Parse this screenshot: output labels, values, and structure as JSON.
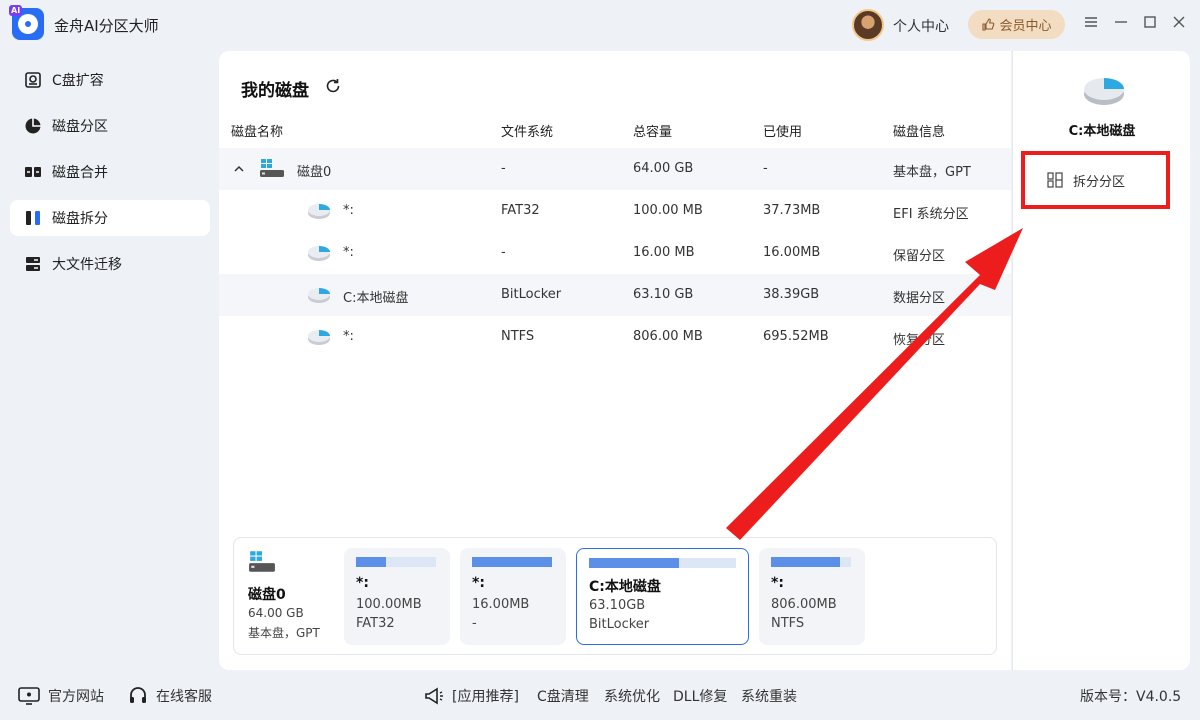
{
  "app": {
    "title": "金舟AI分区大师",
    "logo_badge": "AI"
  },
  "header": {
    "personal_center": "个人中心",
    "vip_center": "会员中心"
  },
  "sidebar": {
    "items": [
      {
        "label": "C盘扩容",
        "icon": "disk-expand-icon"
      },
      {
        "label": "磁盘分区",
        "icon": "pie-partition-icon"
      },
      {
        "label": "磁盘合并",
        "icon": "merge-icon"
      },
      {
        "label": "磁盘拆分",
        "icon": "split-icon",
        "active": true
      },
      {
        "label": "大文件迁移",
        "icon": "file-migrate-icon"
      }
    ]
  },
  "main": {
    "title": "我的磁盘",
    "columns": [
      "磁盘名称",
      "文件系统",
      "总容量",
      "已使用",
      "磁盘信息"
    ],
    "disk_row": {
      "name": "磁盘0",
      "fs": "-",
      "total": "64.00 GB",
      "used": "-",
      "info": "基本盘，GPT"
    },
    "partitions": [
      {
        "name": "*:",
        "fs": "FAT32",
        "total": "100.00 MB",
        "used": "37.73MB",
        "info": "EFI 系统分区"
      },
      {
        "name": "*:",
        "fs": "-",
        "total": "16.00 MB",
        "used": "16.00MB",
        "info": "保留分区"
      },
      {
        "name": "C:本地磁盘",
        "fs": "BitLocker",
        "total": "63.10 GB",
        "used": "38.39GB",
        "info": "数据分区"
      },
      {
        "name": "*:",
        "fs": "NTFS",
        "total": "806.00 MB",
        "used": "695.52MB",
        "info": "恢复分区"
      }
    ]
  },
  "disk_map": {
    "disk": {
      "name": "磁盘0",
      "size": "64.00 GB",
      "type": "基本盘，GPT"
    },
    "cards": [
      {
        "name": "*:",
        "size": "100.00MB",
        "fs": "FAT32",
        "fill": 0.38
      },
      {
        "name": "*:",
        "size": "16.00MB",
        "fs": "-",
        "fill": 1.0
      },
      {
        "name": "C:本地磁盘",
        "size": "63.10GB",
        "fs": "BitLocker",
        "fill": 0.61,
        "selected": true
      },
      {
        "name": "*:",
        "size": "806.00MB",
        "fs": "NTFS",
        "fill": 0.86
      }
    ]
  },
  "right_panel": {
    "title": "C:本地磁盘",
    "split_button": "拆分分区",
    "highlight_color": "#ee1d1d"
  },
  "footer": {
    "website": "官方网站",
    "service": "在线客服",
    "recommend": "[应用推荐]",
    "links": [
      "C盘清理",
      "系统优化",
      "DLL修复",
      "系统重装"
    ],
    "version": "版本号：V4.0.5"
  },
  "colors": {
    "accent": "#2a6df5",
    "bar": "#5b8fe8",
    "arrow": "#ee1d1d"
  }
}
